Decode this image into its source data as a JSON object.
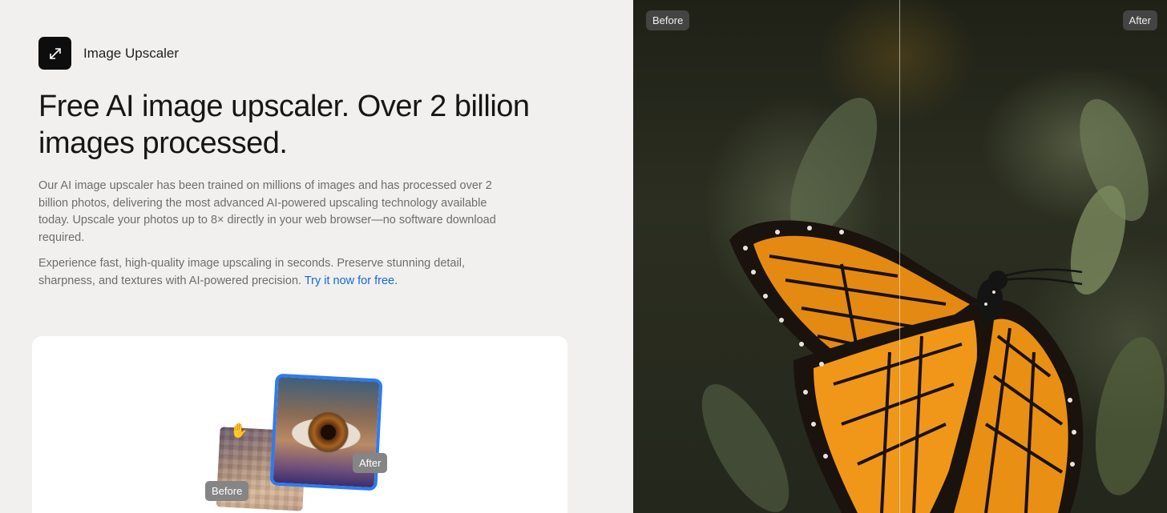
{
  "app": {
    "name": "Image Upscaler",
    "icon": "expand-arrows-icon"
  },
  "hero": {
    "headline": "Free AI image upscaler. Over 2 billion images processed.",
    "paragraph1": "Our AI image upscaler has been trained on millions of images and has processed over 2 billion photos, delivering the most advanced AI-powered upscaling technology available today. Upscale your photos up to 8× directly in your web browser—no software download required.",
    "paragraph2_text": "Experience fast, high-quality image upscaling in seconds. Preserve stunning detail, sharpness, and textures with AI-powered precision. ",
    "paragraph2_link": "Try it now for free."
  },
  "demo_card": {
    "before_label": "Before",
    "after_label": "After",
    "cursor_icon": "grab-hand-icon"
  },
  "comparison": {
    "before_label": "Before",
    "after_label": "After"
  },
  "colors": {
    "accent": "#1667d9",
    "frame_blue": "#2e7bf2",
    "background": "#f1f0ee"
  }
}
